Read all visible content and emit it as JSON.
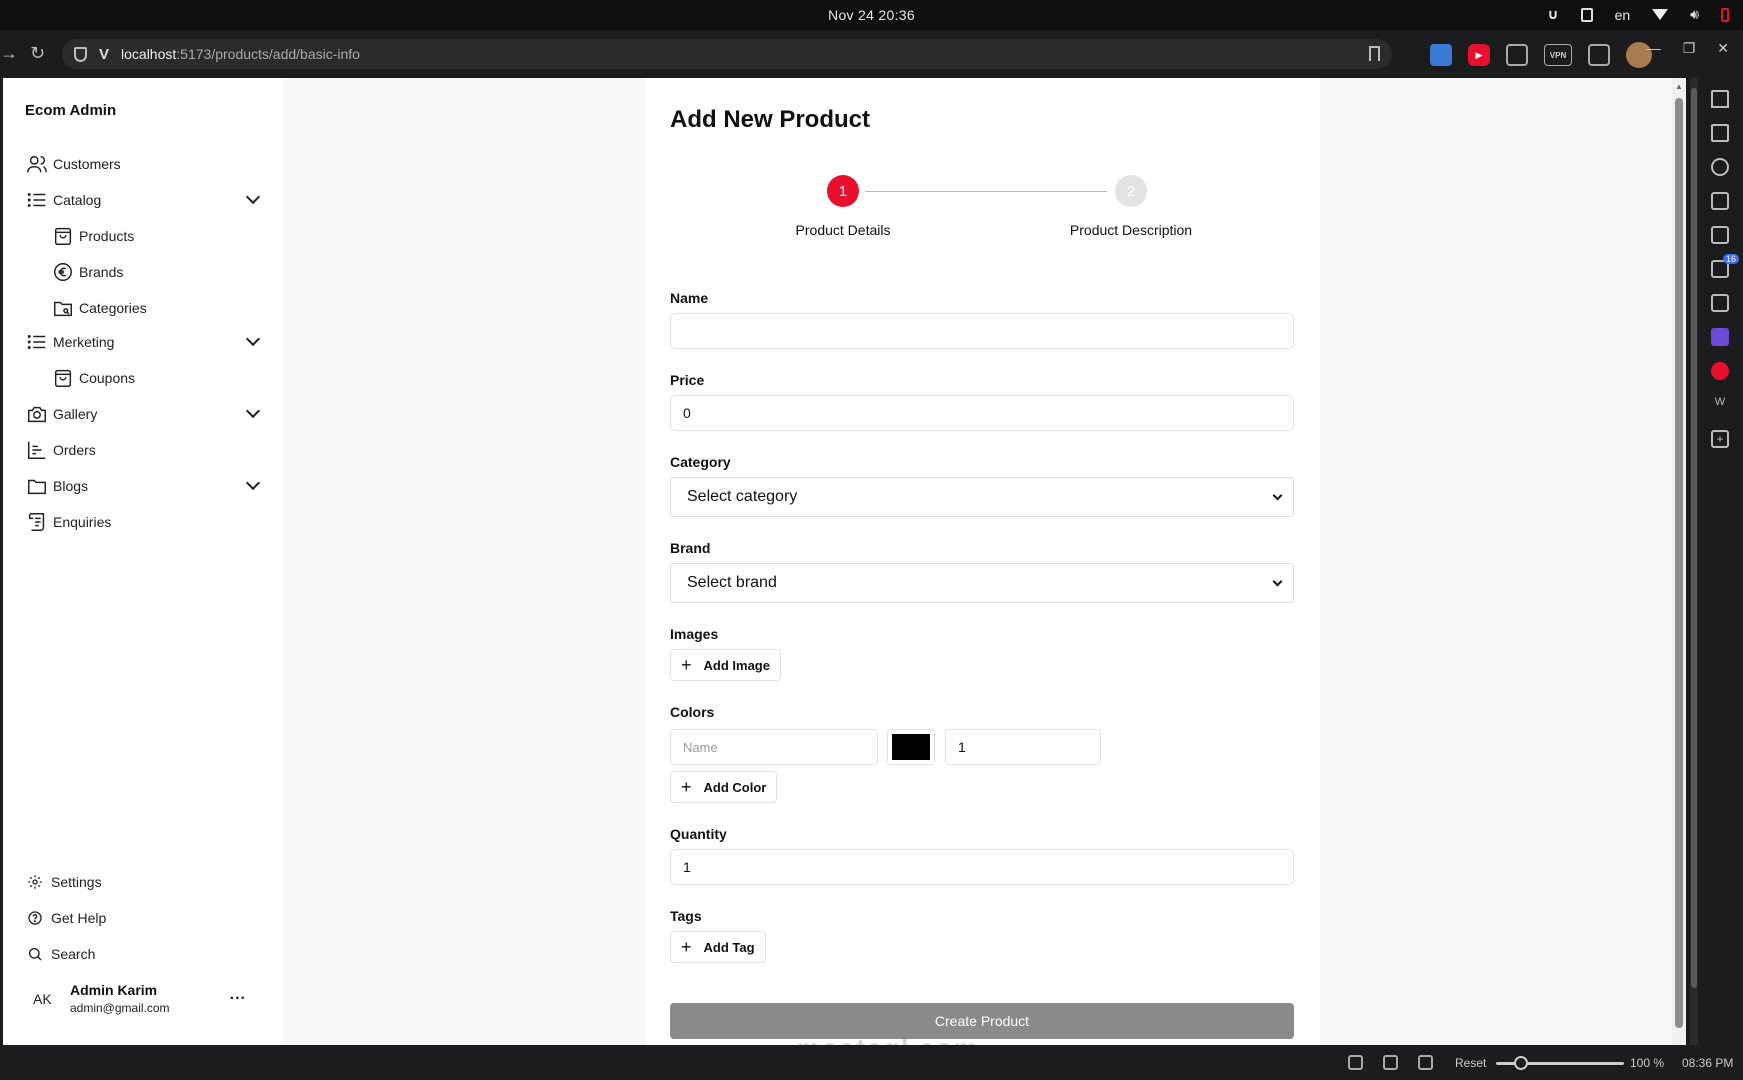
{
  "os": {
    "clock": "Nov 24  20:36",
    "lang": "en"
  },
  "browser": {
    "url_host": "localhost",
    "url_path": ":5173/products/add/basic-info"
  },
  "sidebar": {
    "brand": "Ecom Admin",
    "items": {
      "customers": "Customers",
      "catalog": "Catalog",
      "products": "Products",
      "brands": "Brands",
      "categories": "Categories",
      "marketing": "Merketing",
      "coupons": "Coupons",
      "gallery": "Gallery",
      "orders": "Orders",
      "blogs": "Blogs",
      "enquiries": "Enquiries"
    },
    "bottom": {
      "settings": "Settings",
      "help": "Get Help",
      "search": "Search"
    },
    "user": {
      "initials": "AK",
      "name": "Admin Karim",
      "email": "admin@gmail.com",
      "menu": "..."
    }
  },
  "form": {
    "title": "Add New Product",
    "steps": [
      {
        "number": "1",
        "label": "Product Details",
        "status": "active"
      },
      {
        "number": "2",
        "label": "Product Description",
        "status": "pending"
      }
    ],
    "name_label": "Name",
    "name_value": "",
    "price_label": "Price",
    "price_value": "0",
    "category_label": "Category",
    "category_selected": "Select category",
    "brand_label": "Brand",
    "brand_selected": "Select brand",
    "images_label": "Images",
    "add_image": "Add Image",
    "colors_label": "Colors",
    "color_name_placeholder": "Name",
    "color_value": "#000000",
    "color_qty": "1",
    "add_color": "Add Color",
    "quantity_label": "Quantity",
    "quantity_value": "1",
    "tags_label": "Tags",
    "add_tag": "Add Tag",
    "submit": "Create Product"
  },
  "watermark": "mostaql.com",
  "status_bar": {
    "reset": "Reset",
    "zoom": "100 %",
    "time": "08:36 PM"
  },
  "right_panel": {
    "badge": "16"
  },
  "colors": {
    "accent": "#e8112d",
    "submit_bg": "#8a8a8d"
  }
}
